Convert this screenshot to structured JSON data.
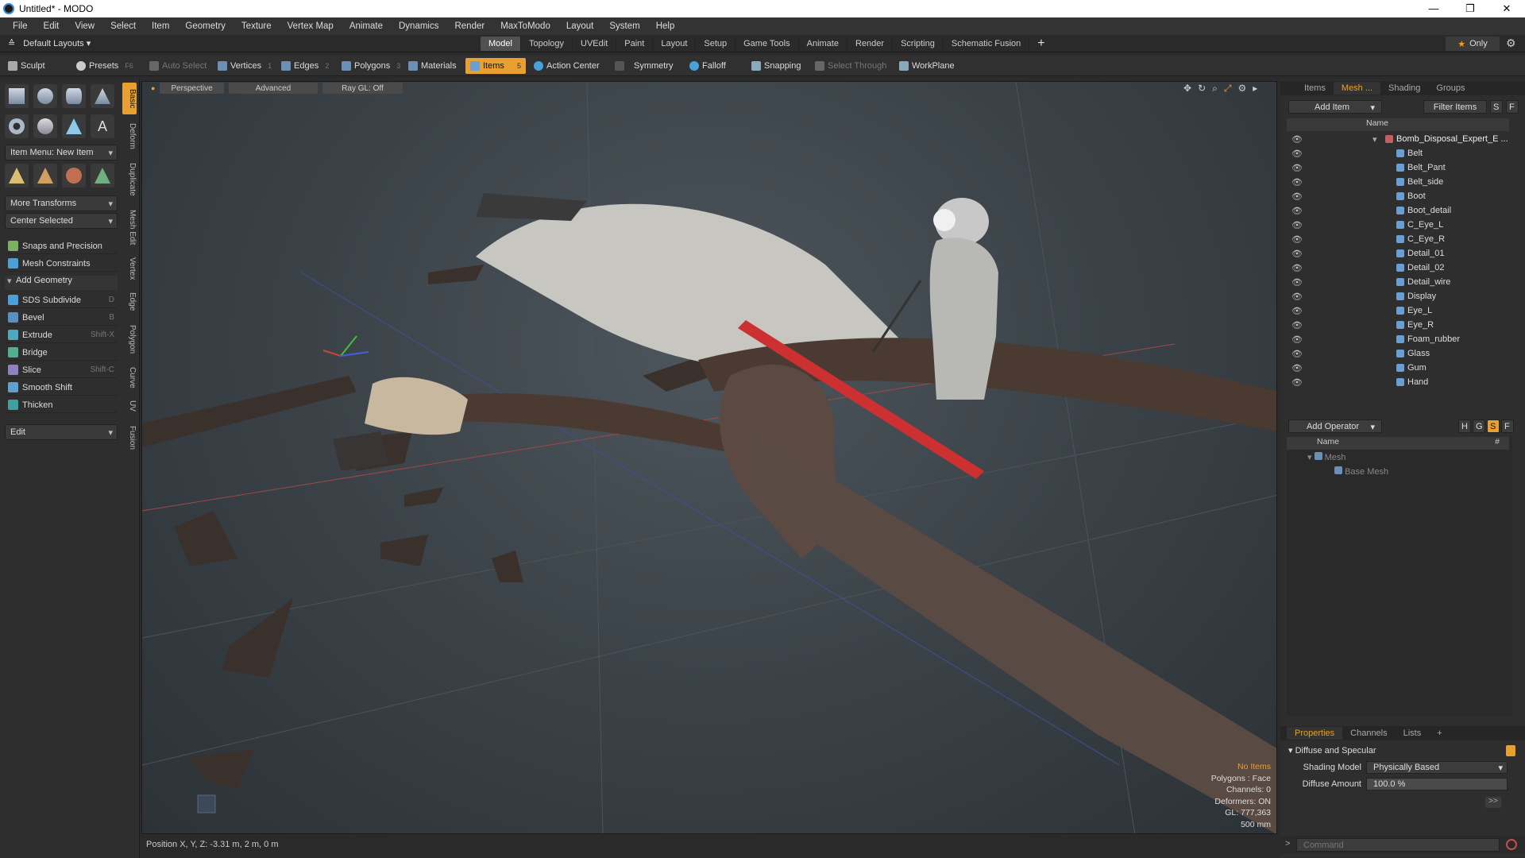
{
  "window": {
    "title": "Untitled* - MODO",
    "controls": [
      "—",
      "❐",
      "✕"
    ]
  },
  "menu": [
    "File",
    "Edit",
    "View",
    "Select",
    "Item",
    "Geometry",
    "Texture",
    "Vertex Map",
    "Animate",
    "Dynamics",
    "Render",
    "MaxToModo",
    "Layout",
    "System",
    "Help"
  ],
  "layouts_label": "Default Layouts",
  "mode_tabs": [
    "Model",
    "Topology",
    "UVEdit",
    "Paint",
    "Layout",
    "Setup",
    "Game Tools",
    "Animate",
    "Render",
    "Scripting",
    "Schematic Fusion"
  ],
  "active_tab": "Model",
  "only_label": "Only",
  "toolbar": {
    "sculpt": "Sculpt",
    "presets": "Presets",
    "presets_key": "F6",
    "auto_select": "Auto Select",
    "vertices": "Vertices",
    "vertices_key": "1",
    "edges": "Edges",
    "edges_key": "2",
    "polygons": "Polygons",
    "polygons_key": "3",
    "materials": "Materials",
    "items": "Items",
    "items_key": "5",
    "action_center": "Action Center",
    "symmetry": "Symmetry",
    "falloff": "Falloff",
    "snapping": "Snapping",
    "select_through": "Select Through",
    "workplane": "WorkPlane"
  },
  "left": {
    "vtabs": [
      "Basic",
      "Deform",
      "Duplicate",
      "Mesh Edit",
      "Vertex",
      "Edge",
      "Polygon",
      "Curve",
      "UV",
      "Fusion"
    ],
    "item_menu": "Item Menu: New Item",
    "more_transforms": "More Transforms",
    "center_selected": "Center Selected",
    "snaps": "Snaps and Precision",
    "mesh_constraints": "Mesh Constraints",
    "add_geometry": "Add Geometry",
    "tools": [
      {
        "label": "SDS Subdivide",
        "key": "D"
      },
      {
        "label": "Bevel",
        "key": "B"
      },
      {
        "label": "Extrude",
        "key": "Shift-X"
      },
      {
        "label": "Bridge",
        "key": ""
      },
      {
        "label": "Slice",
        "key": "Shift-C"
      },
      {
        "label": "Smooth Shift",
        "key": ""
      },
      {
        "label": "Thicken",
        "key": ""
      }
    ],
    "edit": "Edit"
  },
  "viewport": {
    "perspective": "Perspective",
    "advanced": "Advanced",
    "raygl": "Ray GL: Off",
    "info": {
      "items": "No Items",
      "polygons": "Polygons : Face",
      "channels": "Channels: 0",
      "deformers": "Deformers: ON",
      "gl": "GL: 777,363",
      "scale": "500 mm"
    }
  },
  "status": {
    "position": "Position X, Y, Z:  -3.31 m, 2 m, 0 m"
  },
  "right": {
    "top_tabs": [
      "Items",
      "Mesh ...",
      "Shading",
      "Groups"
    ],
    "add_item": "Add Item",
    "filter_items": "Filter Items",
    "s": "S",
    "f": "F",
    "name_col": "Name",
    "parent": "Bomb_Disposal_Expert_E ...",
    "items": [
      "Belt",
      "Belt_Pant",
      "Belt_side",
      "Boot",
      "Boot_detail",
      "C_Eye_L",
      "C_Eye_R",
      "Detail_01",
      "Detail_02",
      "Detail_wire",
      "Display",
      "Eye_L",
      "Eye_R",
      "Foam_rubber",
      "Glass",
      "Gum",
      "Hand"
    ],
    "add_operator": "Add Operator",
    "op_btns": [
      "H",
      "G",
      "S",
      "F"
    ],
    "op_name": "Name",
    "op_hash": "#",
    "op_mesh": "Mesh",
    "op_base": "Base Mesh",
    "prop_tabs": [
      "Properties",
      "Channels",
      "Lists"
    ],
    "diffuse_section": "Diffuse and Specular",
    "shading_model_label": "Shading Model",
    "shading_model": "Physically Based",
    "diffuse_amount_label": "Diffuse Amount",
    "diffuse_amount": "100.0 %",
    "command_placeholder": "Command"
  }
}
